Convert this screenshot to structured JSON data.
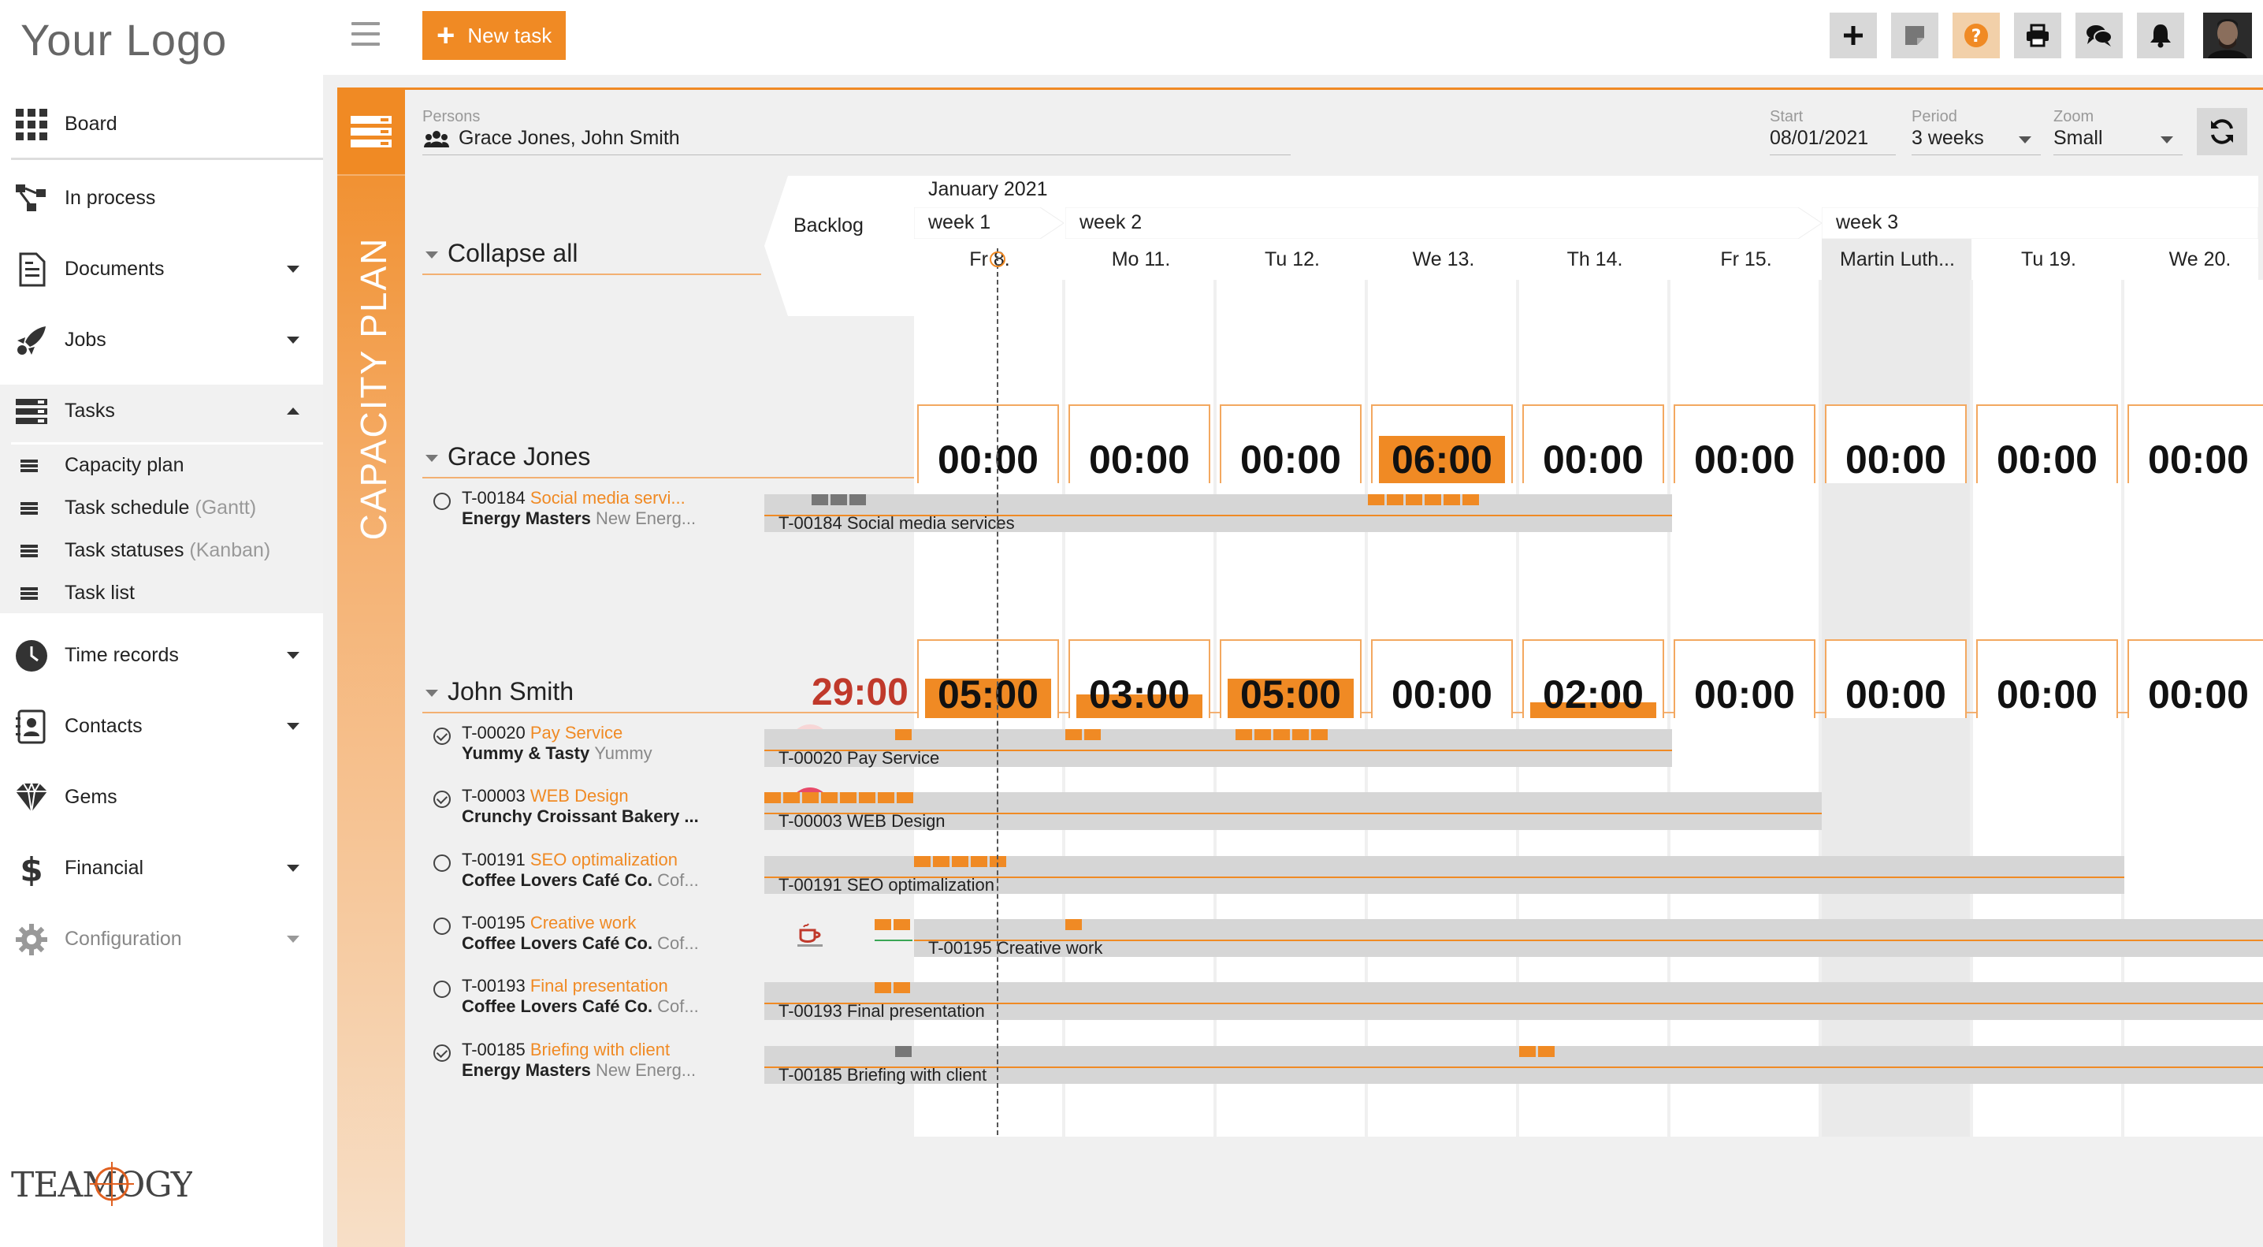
{
  "sidebar": {
    "logo": "Your Logo",
    "items": [
      {
        "label": "Board"
      },
      {
        "label": "In process"
      },
      {
        "label": "Documents"
      },
      {
        "label": "Jobs"
      },
      {
        "label": "Tasks"
      },
      {
        "label": "Time records"
      },
      {
        "label": "Contacts"
      },
      {
        "label": "Gems"
      },
      {
        "label": "Financial"
      },
      {
        "label": "Configuration"
      }
    ],
    "task_sub": [
      {
        "label": "Capacity plan",
        "hint": ""
      },
      {
        "label": "Task schedule",
        "hint": "(Gantt)"
      },
      {
        "label": "Task statuses",
        "hint": "(Kanban)"
      },
      {
        "label": "Task list",
        "hint": ""
      }
    ],
    "brand": "TEAMOGY"
  },
  "topbar": {
    "new_task_label": "New task"
  },
  "filters": {
    "persons_label": "Persons",
    "persons_value": "Grace Jones, John Smith",
    "start_label": "Start",
    "start_value": "08/01/2021",
    "period_label": "Period",
    "period_value": "3 weeks",
    "zoom_label": "Zoom",
    "zoom_value": "Small"
  },
  "plan": {
    "side_title": "CAPACITY PLAN",
    "collapse_all": "Collapse all",
    "backlog": "Backlog",
    "month": "January 2021",
    "weeks": [
      "week 1",
      "week 2",
      "week 3"
    ],
    "days": [
      "Fr 8.",
      "Mo 11.",
      "Tu 12.",
      "We 13.",
      "Th 14.",
      "Fr 15.",
      "Martin Luth...",
      "Tu 19.",
      "We 20."
    ],
    "groups": [
      {
        "name": "Grace Jones",
        "total": "",
        "capacity": [
          {
            "text": "00:00",
            "fill": 0
          },
          {
            "text": "00:00",
            "fill": 0
          },
          {
            "text": "00:00",
            "fill": 0
          },
          {
            "text": "06:00",
            "fill": 0.75
          },
          {
            "text": "00:00",
            "fill": 0
          },
          {
            "text": "00:00",
            "fill": 0
          },
          {
            "text": "00:00",
            "fill": 0
          },
          {
            "text": "00:00",
            "fill": 0
          },
          {
            "text": "00:00",
            "fill": 0
          }
        ],
        "tasks": [
          {
            "code": "T-00184",
            "name": "Social media servi...",
            "client": "Energy Masters",
            "project": "New Energ...",
            "done": false,
            "bar": "T-00184 Social media services",
            "logo": "ENERGY"
          }
        ]
      },
      {
        "name": "John Smith",
        "total": "29:00",
        "capacity": [
          {
            "text": "05:00",
            "fill": 0.625
          },
          {
            "text": "03:00",
            "fill": 0.375
          },
          {
            "text": "05:00",
            "fill": 0.625
          },
          {
            "text": "00:00",
            "fill": 0
          },
          {
            "text": "02:00",
            "fill": 0.25
          },
          {
            "text": "00:00",
            "fill": 0
          },
          {
            "text": "00:00",
            "fill": 0
          },
          {
            "text": "00:00",
            "fill": 0
          },
          {
            "text": "00:00",
            "fill": 0
          }
        ],
        "tasks": [
          {
            "code": "T-00020",
            "name": "Pay Service",
            "client": "Yummy & Tasty",
            "project": "Yummy",
            "done": true,
            "bar": "T-00020 Pay Service",
            "logo": "yummy"
          },
          {
            "code": "T-00003",
            "name": "WEB Design",
            "client": "Crunchy Croissant Bakery ...",
            "project": "",
            "done": true,
            "bar": "T-00003 WEB Design",
            "logo": "croissant"
          },
          {
            "code": "T-00191",
            "name": "SEO optimalization",
            "client": "Coffee Lovers Café Co.",
            "project": "Cof...",
            "done": false,
            "bar": "T-00191 SEO optimalization",
            "logo": "coffee"
          },
          {
            "code": "T-00195",
            "name": "Creative work",
            "client": "Coffee Lovers Café Co.",
            "project": "Cof...",
            "done": false,
            "bar": "T-00195 Creative work",
            "logo": "coffee"
          },
          {
            "code": "T-00193",
            "name": "Final presentation",
            "client": "Coffee Lovers Café Co.",
            "project": "Cof...",
            "done": false,
            "bar": "T-00193 Final presentation",
            "logo": "coffee"
          },
          {
            "code": "T-00185",
            "name": "Briefing with client",
            "client": "Energy Masters",
            "project": "New Energ...",
            "done": true,
            "bar": "T-00185 Briefing with client",
            "logo": "ENERGY"
          }
        ]
      }
    ]
  },
  "colors": {
    "accent": "#f08a24",
    "total_red": "#c0392b",
    "bar_gray": "#d6d6d6"
  }
}
